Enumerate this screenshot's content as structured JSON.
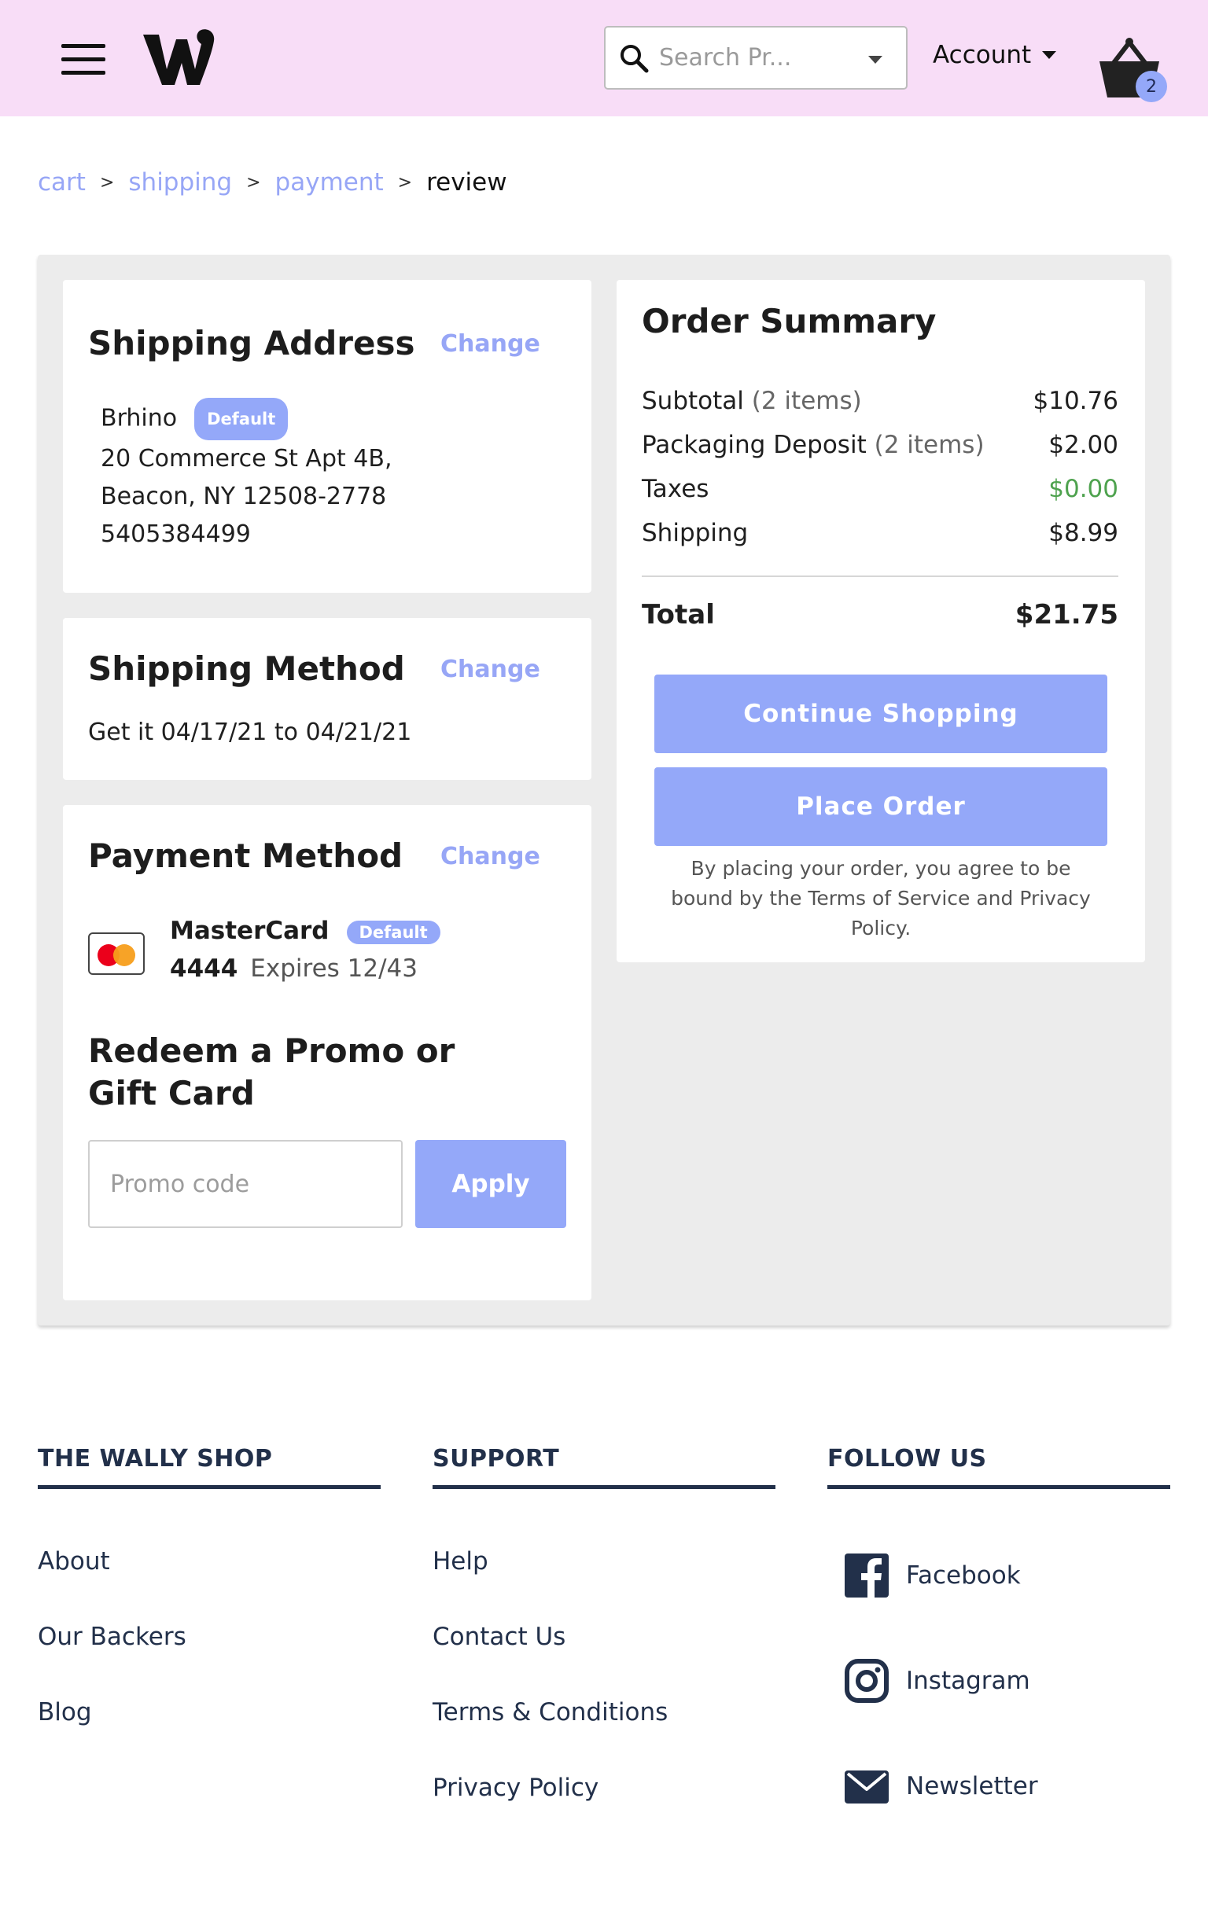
{
  "header": {
    "search_placeholder": "Search Pr...",
    "account_label": "Account",
    "cart_count": "2"
  },
  "breadcrumb": {
    "cart": "cart",
    "shipping": "shipping",
    "payment": "payment",
    "review": "review",
    "separator": ">"
  },
  "shipping_address": {
    "title": "Shipping Address",
    "change": "Change",
    "name": "Brhino",
    "badge": "Default",
    "line1": "20 Commerce St Apt 4B,",
    "line2": "Beacon, NY 12508-2778",
    "phone": "5405384499"
  },
  "shipping_method": {
    "title": "Shipping Method",
    "change": "Change",
    "delivery": "Get it 04/17/21 to 04/21/21"
  },
  "payment_method": {
    "title": "Payment Method",
    "change": "Change",
    "card_name": "MasterCard",
    "badge": "Default",
    "last4": "4444",
    "expires": "Expires 12/43"
  },
  "promo": {
    "title": "Redeem a Promo or Gift Card",
    "placeholder": "Promo code",
    "apply": "Apply"
  },
  "order_summary": {
    "title": "Order Summary",
    "subtotal_label": "Subtotal",
    "subtotal_items": "(2 items)",
    "subtotal_value": "$10.76",
    "deposit_label": "Packaging Deposit",
    "deposit_items": "(2 items)",
    "deposit_value": "$2.00",
    "taxes_label": "Taxes",
    "taxes_value": "$0.00",
    "shipping_label": "Shipping",
    "shipping_value": "$8.99",
    "total_label": "Total",
    "total_value": "$21.75",
    "continue_button": "Continue Shopping",
    "place_order_button": "Place Order",
    "terms": "By placing your order, you agree to be bound by the Terms of Service and Privacy Policy."
  },
  "footer": {
    "col1_title": "THE WALLY SHOP",
    "col1_links": [
      "About",
      "Our Backers",
      "Blog"
    ],
    "col2_title": "SUPPORT",
    "col2_links": [
      "Help",
      "Contact Us",
      "Terms & Conditions",
      "Privacy Policy"
    ],
    "col3_title": "FOLLOW US",
    "social": [
      "Facebook",
      "Instagram",
      "Newsletter"
    ]
  },
  "colors": {
    "header_bg": "#f8ddf7",
    "accent": "#94a8f9",
    "footer_text": "#22304a",
    "tax_green": "#4ea24e"
  },
  "icons": [
    "menu-icon",
    "search-icon",
    "chevron-down-icon",
    "basket-icon",
    "mastercard-icon",
    "facebook-icon",
    "instagram-icon",
    "mail-icon"
  ]
}
